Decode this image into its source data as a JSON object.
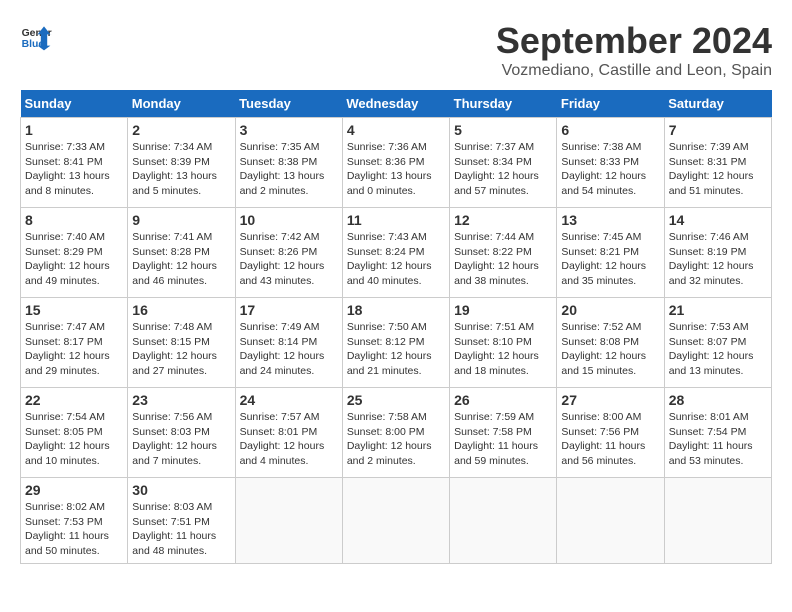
{
  "logo": {
    "line1": "General",
    "line2": "Blue"
  },
  "title": "September 2024",
  "location": "Vozmediano, Castille and Leon, Spain",
  "headers": [
    "Sunday",
    "Monday",
    "Tuesday",
    "Wednesday",
    "Thursday",
    "Friday",
    "Saturday"
  ],
  "weeks": [
    [
      {
        "day": "1",
        "info": "Sunrise: 7:33 AM\nSunset: 8:41 PM\nDaylight: 13 hours\nand 8 minutes."
      },
      {
        "day": "2",
        "info": "Sunrise: 7:34 AM\nSunset: 8:39 PM\nDaylight: 13 hours\nand 5 minutes."
      },
      {
        "day": "3",
        "info": "Sunrise: 7:35 AM\nSunset: 8:38 PM\nDaylight: 13 hours\nand 2 minutes."
      },
      {
        "day": "4",
        "info": "Sunrise: 7:36 AM\nSunset: 8:36 PM\nDaylight: 13 hours\nand 0 minutes."
      },
      {
        "day": "5",
        "info": "Sunrise: 7:37 AM\nSunset: 8:34 PM\nDaylight: 12 hours\nand 57 minutes."
      },
      {
        "day": "6",
        "info": "Sunrise: 7:38 AM\nSunset: 8:33 PM\nDaylight: 12 hours\nand 54 minutes."
      },
      {
        "day": "7",
        "info": "Sunrise: 7:39 AM\nSunset: 8:31 PM\nDaylight: 12 hours\nand 51 minutes."
      }
    ],
    [
      {
        "day": "8",
        "info": "Sunrise: 7:40 AM\nSunset: 8:29 PM\nDaylight: 12 hours\nand 49 minutes."
      },
      {
        "day": "9",
        "info": "Sunrise: 7:41 AM\nSunset: 8:28 PM\nDaylight: 12 hours\nand 46 minutes."
      },
      {
        "day": "10",
        "info": "Sunrise: 7:42 AM\nSunset: 8:26 PM\nDaylight: 12 hours\nand 43 minutes."
      },
      {
        "day": "11",
        "info": "Sunrise: 7:43 AM\nSunset: 8:24 PM\nDaylight: 12 hours\nand 40 minutes."
      },
      {
        "day": "12",
        "info": "Sunrise: 7:44 AM\nSunset: 8:22 PM\nDaylight: 12 hours\nand 38 minutes."
      },
      {
        "day": "13",
        "info": "Sunrise: 7:45 AM\nSunset: 8:21 PM\nDaylight: 12 hours\nand 35 minutes."
      },
      {
        "day": "14",
        "info": "Sunrise: 7:46 AM\nSunset: 8:19 PM\nDaylight: 12 hours\nand 32 minutes."
      }
    ],
    [
      {
        "day": "15",
        "info": "Sunrise: 7:47 AM\nSunset: 8:17 PM\nDaylight: 12 hours\nand 29 minutes."
      },
      {
        "day": "16",
        "info": "Sunrise: 7:48 AM\nSunset: 8:15 PM\nDaylight: 12 hours\nand 27 minutes."
      },
      {
        "day": "17",
        "info": "Sunrise: 7:49 AM\nSunset: 8:14 PM\nDaylight: 12 hours\nand 24 minutes."
      },
      {
        "day": "18",
        "info": "Sunrise: 7:50 AM\nSunset: 8:12 PM\nDaylight: 12 hours\nand 21 minutes."
      },
      {
        "day": "19",
        "info": "Sunrise: 7:51 AM\nSunset: 8:10 PM\nDaylight: 12 hours\nand 18 minutes."
      },
      {
        "day": "20",
        "info": "Sunrise: 7:52 AM\nSunset: 8:08 PM\nDaylight: 12 hours\nand 15 minutes."
      },
      {
        "day": "21",
        "info": "Sunrise: 7:53 AM\nSunset: 8:07 PM\nDaylight: 12 hours\nand 13 minutes."
      }
    ],
    [
      {
        "day": "22",
        "info": "Sunrise: 7:54 AM\nSunset: 8:05 PM\nDaylight: 12 hours\nand 10 minutes."
      },
      {
        "day": "23",
        "info": "Sunrise: 7:56 AM\nSunset: 8:03 PM\nDaylight: 12 hours\nand 7 minutes."
      },
      {
        "day": "24",
        "info": "Sunrise: 7:57 AM\nSunset: 8:01 PM\nDaylight: 12 hours\nand 4 minutes."
      },
      {
        "day": "25",
        "info": "Sunrise: 7:58 AM\nSunset: 8:00 PM\nDaylight: 12 hours\nand 2 minutes."
      },
      {
        "day": "26",
        "info": "Sunrise: 7:59 AM\nSunset: 7:58 PM\nDaylight: 11 hours\nand 59 minutes."
      },
      {
        "day": "27",
        "info": "Sunrise: 8:00 AM\nSunset: 7:56 PM\nDaylight: 11 hours\nand 56 minutes."
      },
      {
        "day": "28",
        "info": "Sunrise: 8:01 AM\nSunset: 7:54 PM\nDaylight: 11 hours\nand 53 minutes."
      }
    ],
    [
      {
        "day": "29",
        "info": "Sunrise: 8:02 AM\nSunset: 7:53 PM\nDaylight: 11 hours\nand 50 minutes."
      },
      {
        "day": "30",
        "info": "Sunrise: 8:03 AM\nSunset: 7:51 PM\nDaylight: 11 hours\nand 48 minutes."
      },
      null,
      null,
      null,
      null,
      null
    ]
  ]
}
